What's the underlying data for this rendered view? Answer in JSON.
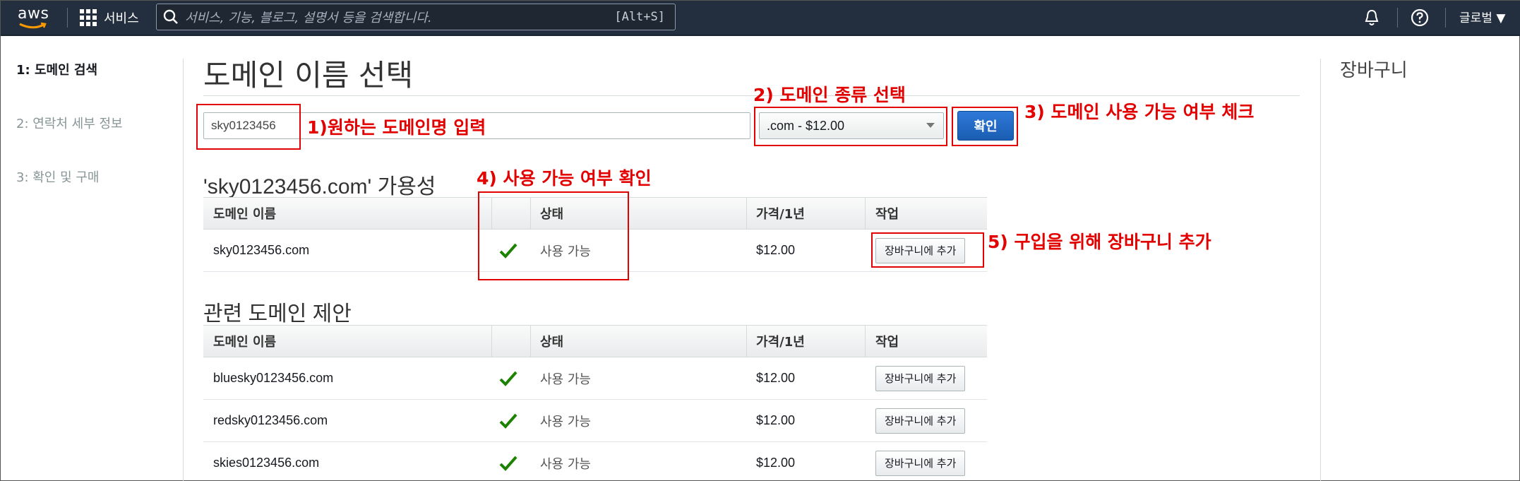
{
  "nav": {
    "logo_text": "aws",
    "services_label": "서비스",
    "search_placeholder": "서비스, 기능, 블로그, 설명서 등을 검색합니다.",
    "search_shortcut": "[Alt+S]",
    "region_label": "글로벌 ▼"
  },
  "steps": [
    {
      "label": "1: 도메인 검색"
    },
    {
      "label": "2: 연락처 세부 정보"
    },
    {
      "label": "3: 확인 및 구매"
    }
  ],
  "page_title": "도메인 이름 선택",
  "search": {
    "domain_value": "sky0123456",
    "tld_selected": ".com - $12.00",
    "confirm_label": "확인"
  },
  "availability": {
    "title": "'sky0123456.com' 가용성",
    "headers": {
      "name": "도메인 이름",
      "status": "상태",
      "price": "가격/1년",
      "action": "작업"
    },
    "rows": [
      {
        "name": "sky0123456.com",
        "status": "사용 가능",
        "price": "$12.00",
        "action": "장바구니에 추가"
      }
    ]
  },
  "suggestions": {
    "title": "관련 도메인 제안",
    "headers": {
      "name": "도메인 이름",
      "status": "상태",
      "price": "가격/1년",
      "action": "작업"
    },
    "rows": [
      {
        "name": "bluesky0123456.com",
        "status": "사용 가능",
        "price": "$12.00",
        "action": "장바구니에 추가"
      },
      {
        "name": "redsky0123456.com",
        "status": "사용 가능",
        "price": "$12.00",
        "action": "장바구니에 추가"
      },
      {
        "name": "skies0123456.com",
        "status": "사용 가능",
        "price": "$12.00",
        "action": "장바구니에 추가"
      }
    ]
  },
  "cart": {
    "title": "장바구니"
  },
  "annotations": {
    "a1": "1)원하는 도메인명 입력",
    "a2": "2) 도메인 종류 선택",
    "a3": "3) 도메인 사용 가능 여부 체크",
    "a4": "4) 사용 가능 여부 확인",
    "a5": "5) 구입을 위해 장바구니 추가",
    "color": "#e30000"
  },
  "colors": {
    "nav_bg": "#232f3e",
    "primary_button": "#1a5db2",
    "check_green": "#1d8102"
  }
}
